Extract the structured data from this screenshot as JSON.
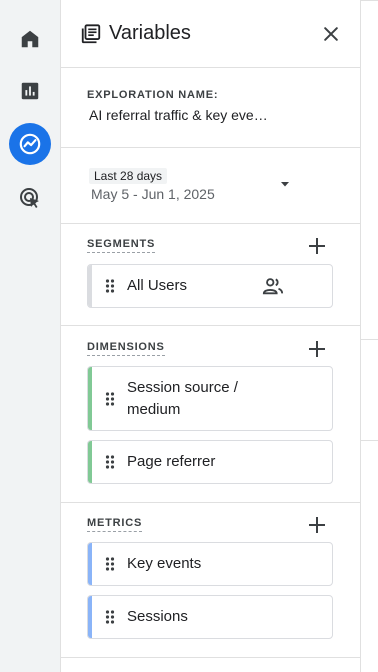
{
  "panel": {
    "title": "Variables"
  },
  "exploration": {
    "label": "EXPLORATION NAME:",
    "value": "AI referral traffic & key eve…"
  },
  "date": {
    "chip": "Last 28 days",
    "range": "May 5 - Jun 1, 2025"
  },
  "segments": {
    "title": "SEGMENTS",
    "items": [
      {
        "label": "All Users"
      }
    ]
  },
  "dimensions": {
    "title": "DIMENSIONS",
    "items": [
      {
        "label": "Session source / medium"
      },
      {
        "label": "Page referrer"
      }
    ],
    "accent": "#81c995"
  },
  "metrics": {
    "title": "METRICS",
    "items": [
      {
        "label": "Key events"
      },
      {
        "label": "Sessions"
      }
    ],
    "accent": "#8ab4f8"
  },
  "colors": {
    "active_rail": "#1a73e8",
    "segment_bar": "#dadce0"
  },
  "icons": {
    "rail": [
      "home-icon",
      "reports-icon",
      "explore-icon",
      "advertising-icon"
    ],
    "header": "variables-icon",
    "close": "close-icon"
  }
}
